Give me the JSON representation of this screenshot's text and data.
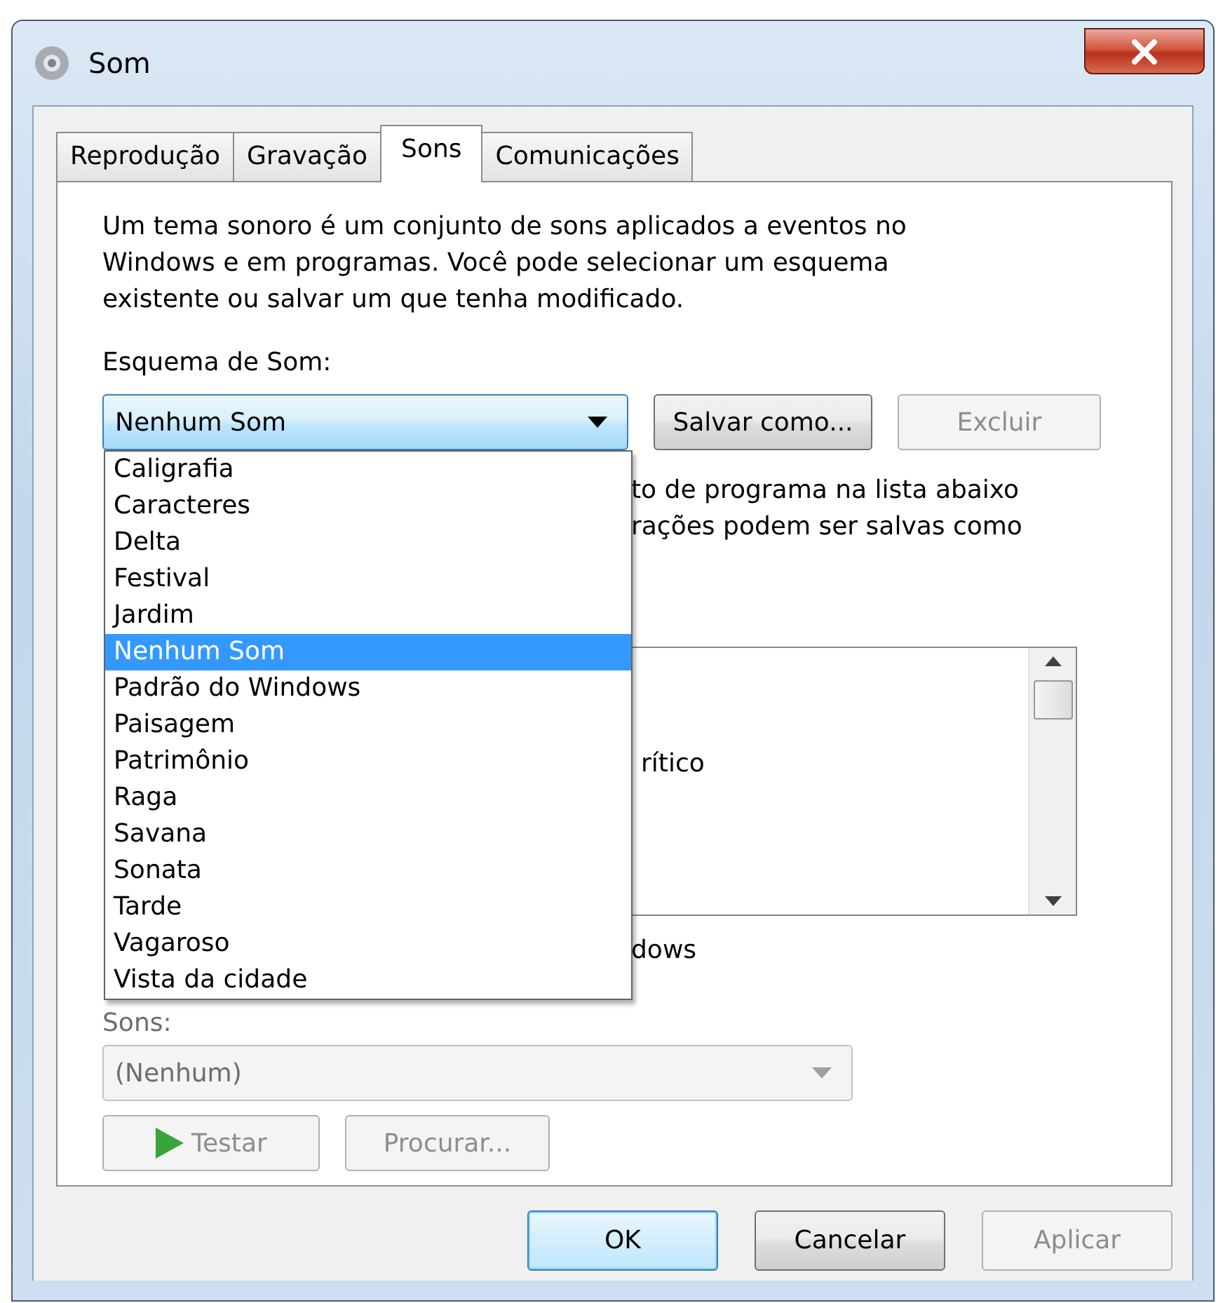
{
  "window": {
    "title": "Som"
  },
  "tabs": [
    {
      "label": "Reprodução",
      "selected": false
    },
    {
      "label": "Gravação",
      "selected": false
    },
    {
      "label": "Sons",
      "selected": true
    },
    {
      "label": "Comunicações",
      "selected": false
    }
  ],
  "description": "Um tema sonoro é um conjunto de sons aplicados a eventos no Windows e em programas. Você pode selecionar um esquema existente ou salvar um que tenha modificado.",
  "scheme": {
    "label": "Esquema de Som:",
    "value": "Nenhum Som",
    "expanded": true,
    "options": [
      {
        "label": "Caligrafia",
        "selected": false
      },
      {
        "label": "Caracteres",
        "selected": false
      },
      {
        "label": "Delta",
        "selected": false
      },
      {
        "label": "Festival",
        "selected": false
      },
      {
        "label": "Jardim",
        "selected": false
      },
      {
        "label": "Nenhum Som",
        "selected": true
      },
      {
        "label": "Padrão do Windows",
        "selected": false
      },
      {
        "label": "Paisagem",
        "selected": false
      },
      {
        "label": "Patrimônio",
        "selected": false
      },
      {
        "label": "Raga",
        "selected": false
      },
      {
        "label": "Savana",
        "selected": false
      },
      {
        "label": "Sonata",
        "selected": false
      },
      {
        "label": "Tarde",
        "selected": false
      },
      {
        "label": "Vagaroso",
        "selected": false
      },
      {
        "label": "Vista da cidade",
        "selected": false
      }
    ]
  },
  "scheme_buttons": [
    {
      "label": "Salvar como...",
      "disabled": false
    },
    {
      "label": "Excluir",
      "disabled": true
    }
  ],
  "partial_text": [
    "to de programa na lista abaixo",
    "rações podem ser salvas como"
  ],
  "events_list": {
    "items": [
      "rítico"
    ]
  },
  "startup_option": {
    "label": "dows"
  },
  "sounds": {
    "label": "Sons:",
    "value": "(Nenhum)",
    "disabled": true
  },
  "sound_buttons": [
    {
      "label": "Testar",
      "kind": "play",
      "disabled": true
    },
    {
      "label": "Procurar...",
      "kind": "plain",
      "disabled": true
    }
  ],
  "footer_buttons": [
    {
      "label": "OK",
      "default": true,
      "disabled": false
    },
    {
      "label": "Cancelar",
      "default": false,
      "disabled": false
    },
    {
      "label": "Aplicar",
      "default": false,
      "disabled": true
    }
  ]
}
